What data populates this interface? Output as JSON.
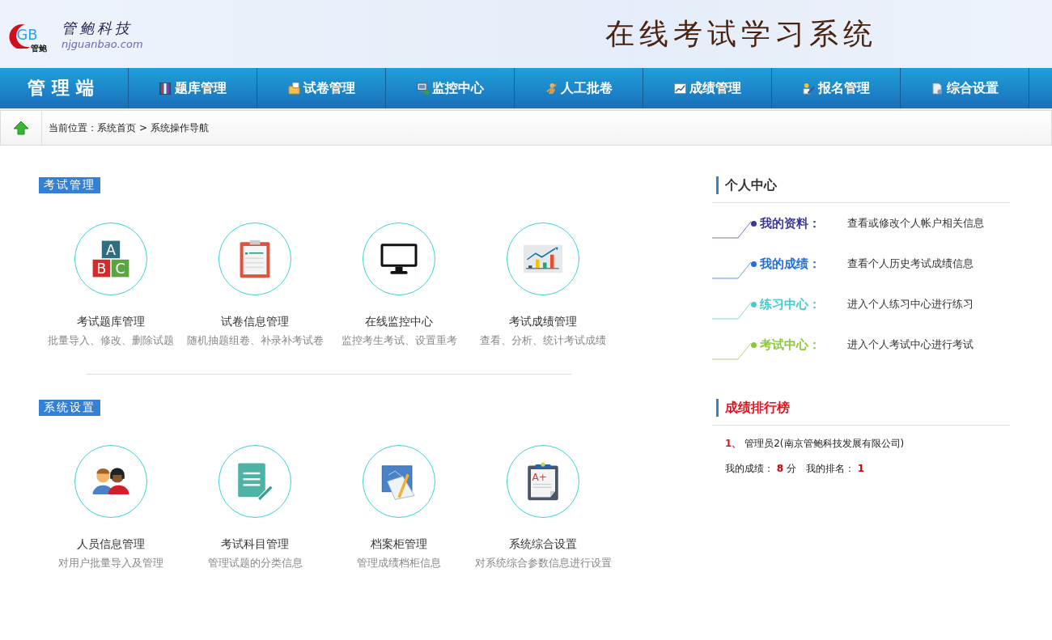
{
  "header": {
    "logo_letters": "GB",
    "logo_mark": "管鲍",
    "company": "管鲍科技",
    "website": "njguanbao.com",
    "title": "在线考试学习系统"
  },
  "nav": {
    "brand": "管理端",
    "items": [
      {
        "label": "题库管理",
        "kind": "books"
      },
      {
        "label": "试卷管理",
        "kind": "folder"
      },
      {
        "label": "监控中心",
        "kind": "computer"
      },
      {
        "label": "人工批卷",
        "kind": "person"
      },
      {
        "label": "成绩管理",
        "kind": "chart"
      },
      {
        "label": "报名管理",
        "kind": "pencil"
      },
      {
        "label": "综合设置",
        "kind": "document"
      }
    ]
  },
  "breadcrumb": {
    "label": "当前位置：",
    "links": [
      "系统首页",
      "系统操作导航"
    ],
    "separator": ">"
  },
  "sections": [
    {
      "title": "考试管理",
      "items": [
        {
          "title": "考试题库管理",
          "desc": "批量导入、修改、删除试题",
          "kind": "blocks",
          "icon_letters": [
            "A",
            "B",
            "C"
          ]
        },
        {
          "title": "试卷信息管理",
          "desc": "随机抽题组卷、补录补考试卷",
          "kind": "clipboard"
        },
        {
          "title": "在线监控中心",
          "desc": "监控考生考试、设置重考",
          "kind": "monitor"
        },
        {
          "title": "考试成绩管理",
          "desc": "查看、分析、统计考试成绩",
          "kind": "chart"
        }
      ]
    },
    {
      "title": "系统设置",
      "items": [
        {
          "title": "人员信息管理",
          "desc": "对用户批量导入及管理",
          "kind": "people"
        },
        {
          "title": "考试科目管理",
          "desc": "管理试题的分类信息",
          "kind": "notepad"
        },
        {
          "title": "档案柜管理",
          "desc": "管理成绩档柜信息",
          "kind": "blueprint"
        },
        {
          "title": "系统综合设置",
          "desc": "对系统综合参数信息进行设置",
          "kind": "grade",
          "icon_letters": [
            "A+"
          ]
        }
      ]
    }
  ],
  "personal": {
    "title": "个人中心",
    "items": [
      {
        "label": "我的资料：",
        "desc": "查看或修改个人帐户相关信息",
        "color": "#3a3a9a"
      },
      {
        "label": "我的成绩：",
        "desc": "查看个人历史考试成绩信息",
        "color": "#1e6fd9"
      },
      {
        "label": "练习中心：",
        "desc": "进入个人练习中心进行练习",
        "color": "#4cc8d0"
      },
      {
        "label": "考试中心：",
        "desc": "进入个人考试中心进行考试",
        "color": "#8cc63f"
      }
    ]
  },
  "ranking": {
    "title": "成绩排行榜",
    "entries": [
      {
        "rank": "1、",
        "name": "管理员2(南京管鲍科技发展有限公司)"
      }
    ],
    "score_label": "我的成绩：",
    "score": "8",
    "score_unit": "分",
    "rank_label": "我的排名：",
    "rank": "1"
  }
}
